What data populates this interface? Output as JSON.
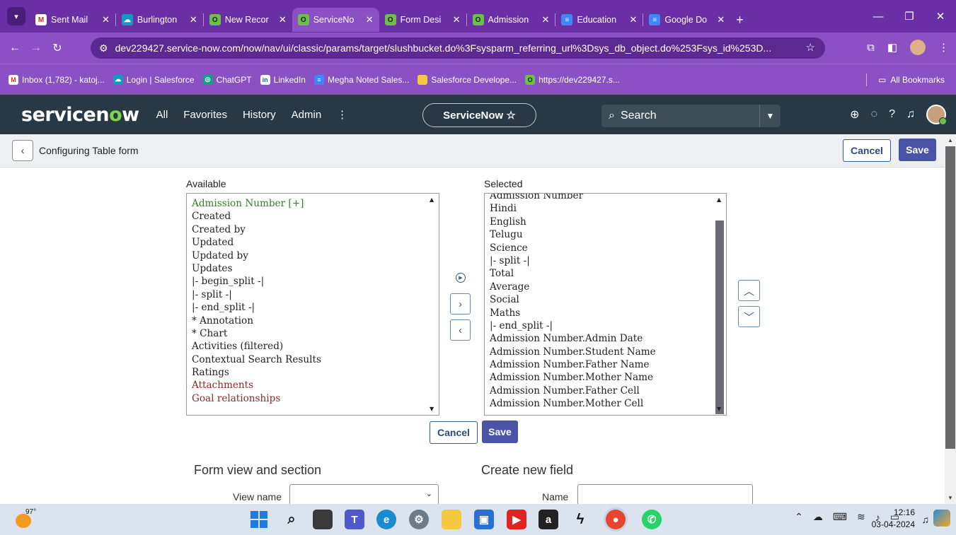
{
  "browser": {
    "tabs": [
      {
        "label": "Sent Mail",
        "icon": "gmail-icon",
        "active": false
      },
      {
        "label": "Burlington",
        "icon": "salesforce-icon",
        "active": false
      },
      {
        "label": "New Recor",
        "icon": "servicenow-icon",
        "active": false
      },
      {
        "label": "ServiceNo",
        "icon": "servicenow-icon",
        "active": true
      },
      {
        "label": "Form Desi",
        "icon": "servicenow-icon",
        "active": false
      },
      {
        "label": "Admission",
        "icon": "servicenow-icon",
        "active": false
      },
      {
        "label": "Education",
        "icon": "google-docs-icon",
        "active": false
      },
      {
        "label": "Google Do",
        "icon": "google-docs-icon",
        "active": false
      }
    ],
    "new_tab": "+",
    "url": "dev229427.service-now.com/now/nav/ui/classic/params/target/slushbucket.do%3Fsysparm_referring_url%3Dsys_db_object.do%253Fsys_id%253D...",
    "bookmarks": [
      {
        "label": "Inbox (1,782) - katoj...",
        "icon": "gmail-icon"
      },
      {
        "label": "Login | Salesforce",
        "icon": "salesforce-icon"
      },
      {
        "label": "ChatGPT",
        "icon": "chatgpt-icon"
      },
      {
        "label": "LinkedIn",
        "icon": "linkedin-icon"
      },
      {
        "label": "Megha Noted Sales...",
        "icon": "google-docs-icon"
      },
      {
        "label": "Salesforce Develope...",
        "icon": "folder-icon"
      },
      {
        "label": "https://dev229427.s...",
        "icon": "servicenow-icon"
      }
    ],
    "all_bookmarks": "All Bookmarks"
  },
  "servicenow": {
    "logo_prefix": "servicen",
    "logo_o": "o",
    "logo_suffix": "w",
    "nav": [
      "All",
      "Favorites",
      "History",
      "Admin",
      "⋮"
    ],
    "scope_pill": "ServiceNow ☆",
    "search_placeholder": "Search"
  },
  "form": {
    "title": "Configuring Table form",
    "cancel_label": "Cancel",
    "save_label": "Save",
    "available_label": "Available",
    "selected_label": "Selected",
    "available_items": [
      {
        "text": "Admission Number [+]",
        "color": "#3a7d2e"
      },
      {
        "text": "Created",
        "color": "#222222"
      },
      {
        "text": "Created by",
        "color": "#222222"
      },
      {
        "text": "Updated",
        "color": "#222222"
      },
      {
        "text": "Updated by",
        "color": "#222222"
      },
      {
        "text": "Updates",
        "color": "#222222"
      },
      {
        "text": "|- begin_split -|",
        "color": "#222222"
      },
      {
        "text": "|- split -|",
        "color": "#222222"
      },
      {
        "text": "|- end_split -|",
        "color": "#222222"
      },
      {
        "text": "* Annotation",
        "color": "#222222"
      },
      {
        "text": "* Chart",
        "color": "#222222"
      },
      {
        "text": "Activities (filtered)",
        "color": "#222222"
      },
      {
        "text": "Contextual Search Results",
        "color": "#222222"
      },
      {
        "text": "Ratings",
        "color": "#222222"
      },
      {
        "text": "Attachments",
        "color": "#8b2a2a"
      },
      {
        "text": "Goal relationships",
        "color": "#8b2a2a"
      }
    ],
    "selected_items": [
      "Admission Number",
      "Hindi",
      "English",
      "Telugu",
      "Science",
      "|- split -|",
      "Total",
      "Average",
      "Social",
      "Maths",
      "|- end_split -|",
      "Admission Number.Admin Date",
      "Admission Number.Student Name",
      "Admission Number.Father Name",
      "Admission Number.Mother Name",
      "Admission Number.Father Cell",
      "Admission Number.Mother Cell"
    ],
    "view_section_title": "Form view and section",
    "view_name_label": "View name",
    "create_field_title": "Create new field",
    "name_label": "Name"
  },
  "taskbar": {
    "weather": "97°",
    "time": "12:16",
    "date": "03-04-2024"
  }
}
